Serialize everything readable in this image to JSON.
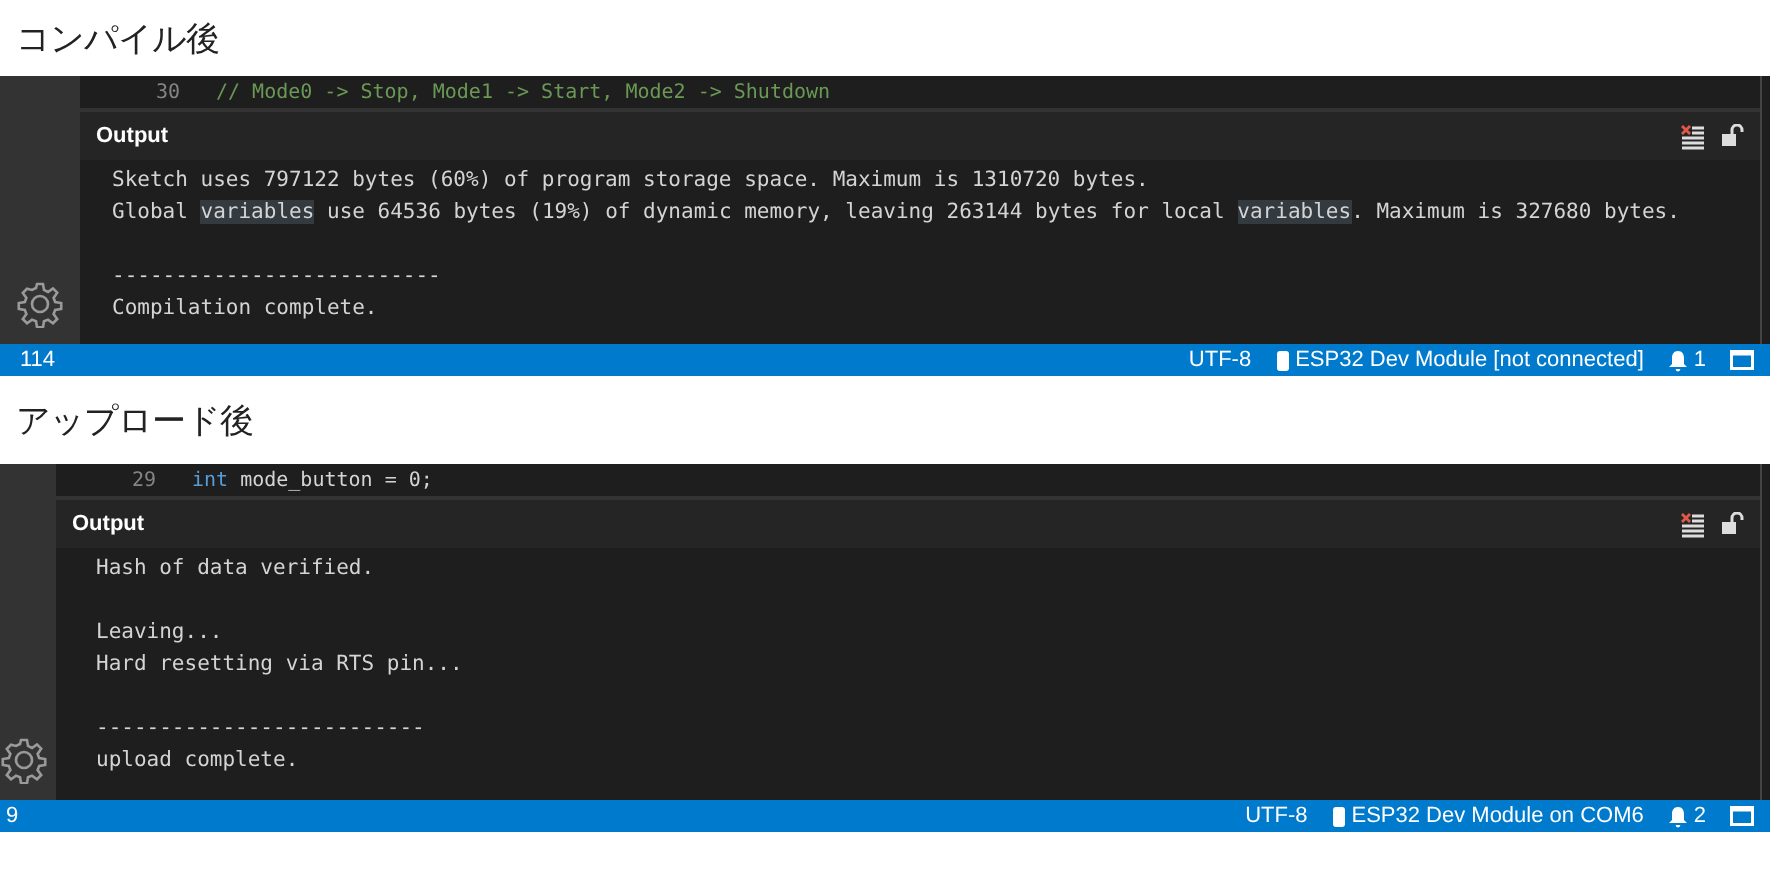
{
  "panels": [
    {
      "caption": "コンパイル後",
      "code_line": {
        "number": "30",
        "kind": "comment",
        "text": "// Mode0 -> Stop, Mode1 -> Start, Mode2 -> Shutdown"
      },
      "output_title": "Output",
      "lines": [
        {
          "kind": "text",
          "segments": [
            {
              "text": "Sketch uses 797122 bytes (60%) of program storage space. Maximum is 1310720 bytes.",
              "highlighted": false
            }
          ]
        },
        {
          "kind": "text",
          "segments": [
            {
              "text": "Global ",
              "highlighted": false
            },
            {
              "text": "variables",
              "highlighted": true
            },
            {
              "text": " use 64536 bytes (19%) of dynamic memory, leaving 263144 bytes for local ",
              "highlighted": false
            },
            {
              "text": "variables",
              "highlighted": true
            },
            {
              "text": ". Maximum is 327680 bytes.",
              "highlighted": false
            }
          ]
        },
        {
          "kind": "blank"
        },
        {
          "kind": "text",
          "segments": [
            {
              "text": "--------------------------",
              "highlighted": false
            }
          ]
        },
        {
          "kind": "text",
          "segments": [
            {
              "text": "Compilation complete.",
              "highlighted": false
            }
          ]
        }
      ],
      "status": {
        "line": "114",
        "encoding": "UTF-8",
        "board": "ESP32 Dev Module [not connected]",
        "notifications": "1"
      }
    },
    {
      "caption": "アップロード後",
      "code_line": {
        "number": "29",
        "kind": "code",
        "keyword": "int",
        "text": " mode_button = 0;"
      },
      "output_title": "Output",
      "lines": [
        {
          "kind": "text",
          "segments": [
            {
              "text": "Hash of data verified.",
              "highlighted": false
            }
          ]
        },
        {
          "kind": "blank"
        },
        {
          "kind": "text",
          "segments": [
            {
              "text": "Leaving...",
              "highlighted": false
            }
          ]
        },
        {
          "kind": "text",
          "segments": [
            {
              "text": "Hard resetting via RTS pin...",
              "highlighted": false
            }
          ]
        },
        {
          "kind": "blank"
        },
        {
          "kind": "text",
          "segments": [
            {
              "text": "--------------------------",
              "highlighted": false
            }
          ]
        },
        {
          "kind": "text",
          "segments": [
            {
              "text": "upload complete.",
              "highlighted": false
            }
          ]
        }
      ],
      "status": {
        "line": "9",
        "encoding": "UTF-8",
        "board": "ESP32 Dev Module on COM6",
        "notifications": "2"
      }
    }
  ]
}
